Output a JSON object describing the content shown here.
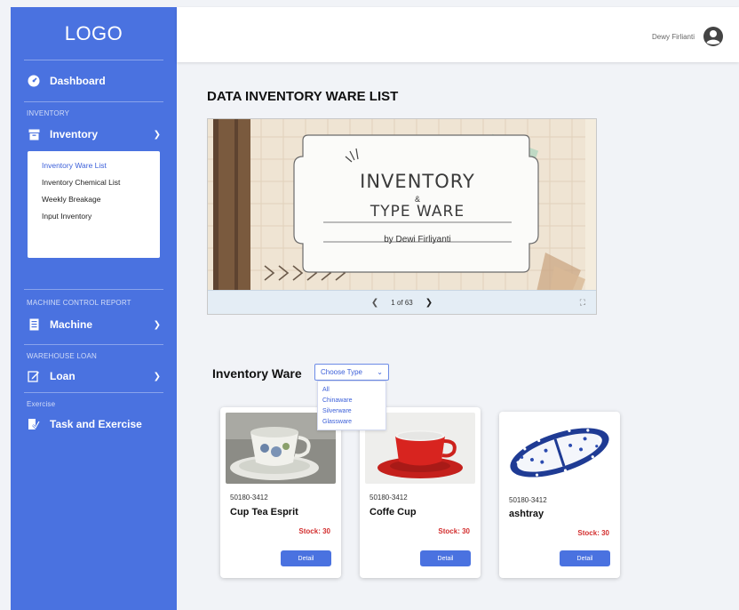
{
  "sidebar": {
    "logo": "LOGO",
    "dashboard": "Dashboard",
    "section_inventory": "INVENTORY",
    "inventory": "Inventory",
    "submenu": [
      "Inventory Ware List",
      "Inventory Chemical List",
      "Weekly Breakage",
      "Input Inventory"
    ],
    "section_machine": "MACHINE CONTROL REPORT",
    "machine": "Machine",
    "section_warehouse": "WAREHOUSE LOAN",
    "loan": "Loan",
    "section_exercise": "Exercise",
    "task": "Task and Exercise"
  },
  "header": {
    "user_name": "Dewy Firlianti"
  },
  "page": {
    "title": "DATA INVENTORY WARE LIST"
  },
  "viewer": {
    "slide_title_line1": "INVENTORY",
    "slide_amp": "&",
    "slide_title_line2": "TYPE WARE",
    "slide_author": "by Dewi Firliyanti",
    "page_indicator": "1 of 63"
  },
  "inventory_ware": {
    "title": "Inventory Ware",
    "dropdown_label": "Choose Type",
    "options": [
      "All",
      "Chinaware",
      "Silverware",
      "Glassware"
    ],
    "items": [
      {
        "code": "50180-3412",
        "name": "Cup Tea Esprit",
        "stock": "Stock: 30",
        "button": "Detail"
      },
      {
        "code": "50180-3412",
        "name": "Coffe Cup",
        "stock": "Stock: 30",
        "button": "Detail"
      },
      {
        "code": "50180-3412",
        "name": "ashtray",
        "stock": "Stock: 30",
        "button": "Detail"
      }
    ]
  },
  "colors": {
    "primary": "#4a72e0",
    "stock_red": "#d32f2f"
  }
}
